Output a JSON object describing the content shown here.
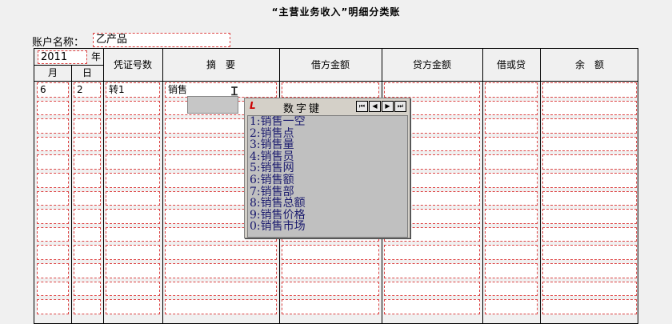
{
  "title": "“主营业务收入”明细分类账",
  "account": {
    "label": "账户名称：",
    "value": "乙产品"
  },
  "header": {
    "year": "2011",
    "year_unit": "年",
    "month": "月",
    "day": "日",
    "voucher": "凭证号数",
    "summary": "摘　要",
    "debit": "借方金额",
    "credit": "贷方金额",
    "dc": "借或贷",
    "balance": "余　额"
  },
  "rows": [
    {
      "month": "6",
      "day": "2",
      "voucher": "转1",
      "summary": "销售"
    }
  ],
  "keypad": {
    "logo": "L",
    "title": "数字键",
    "nav": [
      "⏮",
      "◀",
      "▶",
      "⏭"
    ],
    "items": [
      "1:销售一空",
      "2:销售点",
      "3:销售量",
      "4:销售员",
      "5:销售网",
      "6:销售额",
      "7:销售部",
      "8:销售总额",
      "9:销售价格",
      "0:销售市场"
    ]
  }
}
